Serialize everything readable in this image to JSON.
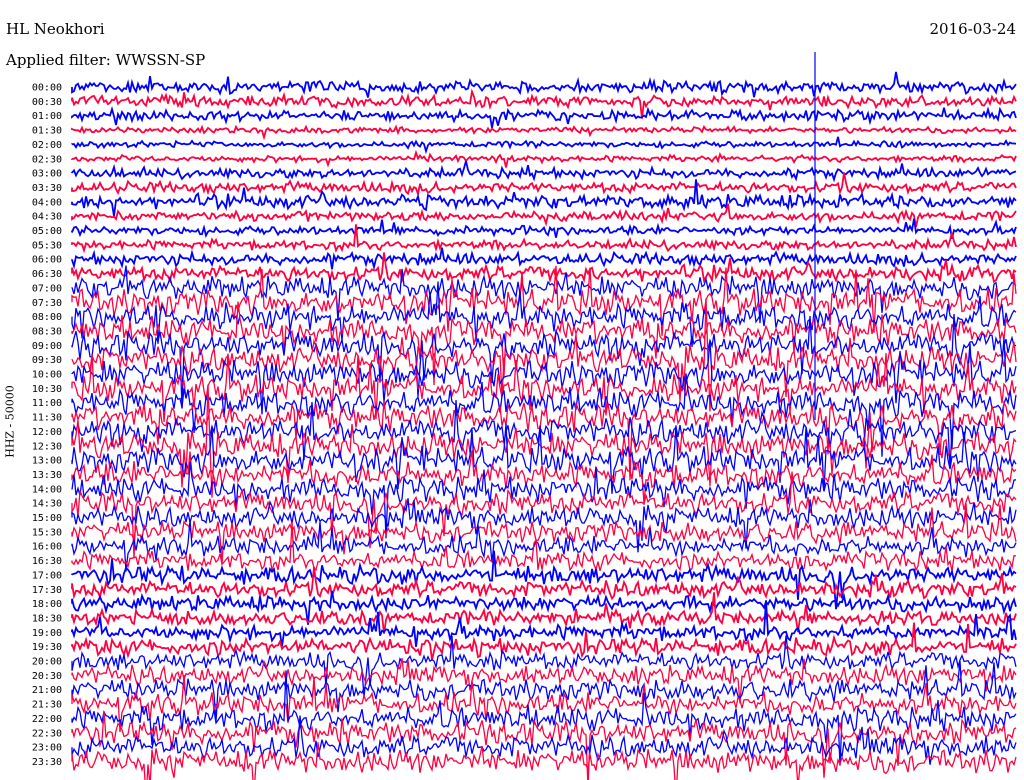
{
  "header": {
    "station": "HL Neokhori",
    "date": "2016-03-24",
    "filter": "Applied filter: WWSSN-SP"
  },
  "chart_data": {
    "type": "line",
    "title": "HL Neokhori",
    "ylabel": "HHZ - 50000",
    "row_labels": [
      "00:00",
      "00:30",
      "01:00",
      "01:30",
      "02:00",
      "02:30",
      "03:00",
      "03:30",
      "04:00",
      "04:30",
      "05:00",
      "05:30",
      "06:00",
      "06:30",
      "07:00",
      "07:30",
      "08:00",
      "08:30",
      "09:00",
      "09:30",
      "10:00",
      "10:30",
      "11:00",
      "11:30",
      "12:00",
      "12:30",
      "13:00",
      "13:30",
      "14:00",
      "14:30",
      "15:00",
      "15:30",
      "16:00",
      "16:30",
      "17:00",
      "17:30",
      "18:00",
      "18:30",
      "19:00",
      "19:30",
      "20:00",
      "20:30",
      "21:00",
      "21:30",
      "22:00",
      "22:30",
      "23:00",
      "23:30"
    ],
    "series_colors": [
      "#0000ff",
      "#ff0040"
    ],
    "activity_level": [
      0.35,
      0.3,
      0.28,
      0.08,
      0.08,
      0.1,
      0.25,
      0.3,
      0.45,
      0.25,
      0.2,
      0.25,
      0.35,
      0.5,
      0.85,
      1.0,
      1.0,
      1.0,
      1.0,
      1.0,
      1.0,
      1.0,
      1.0,
      1.0,
      1.0,
      1.0,
      1.0,
      0.95,
      0.9,
      0.85,
      0.8,
      0.75,
      0.7,
      0.65,
      0.6,
      0.55,
      0.5,
      0.45,
      0.5,
      0.55,
      0.65,
      0.7,
      0.75,
      0.8,
      0.85,
      0.85,
      0.85,
      0.85
    ],
    "legend": "none",
    "grid": false
  }
}
